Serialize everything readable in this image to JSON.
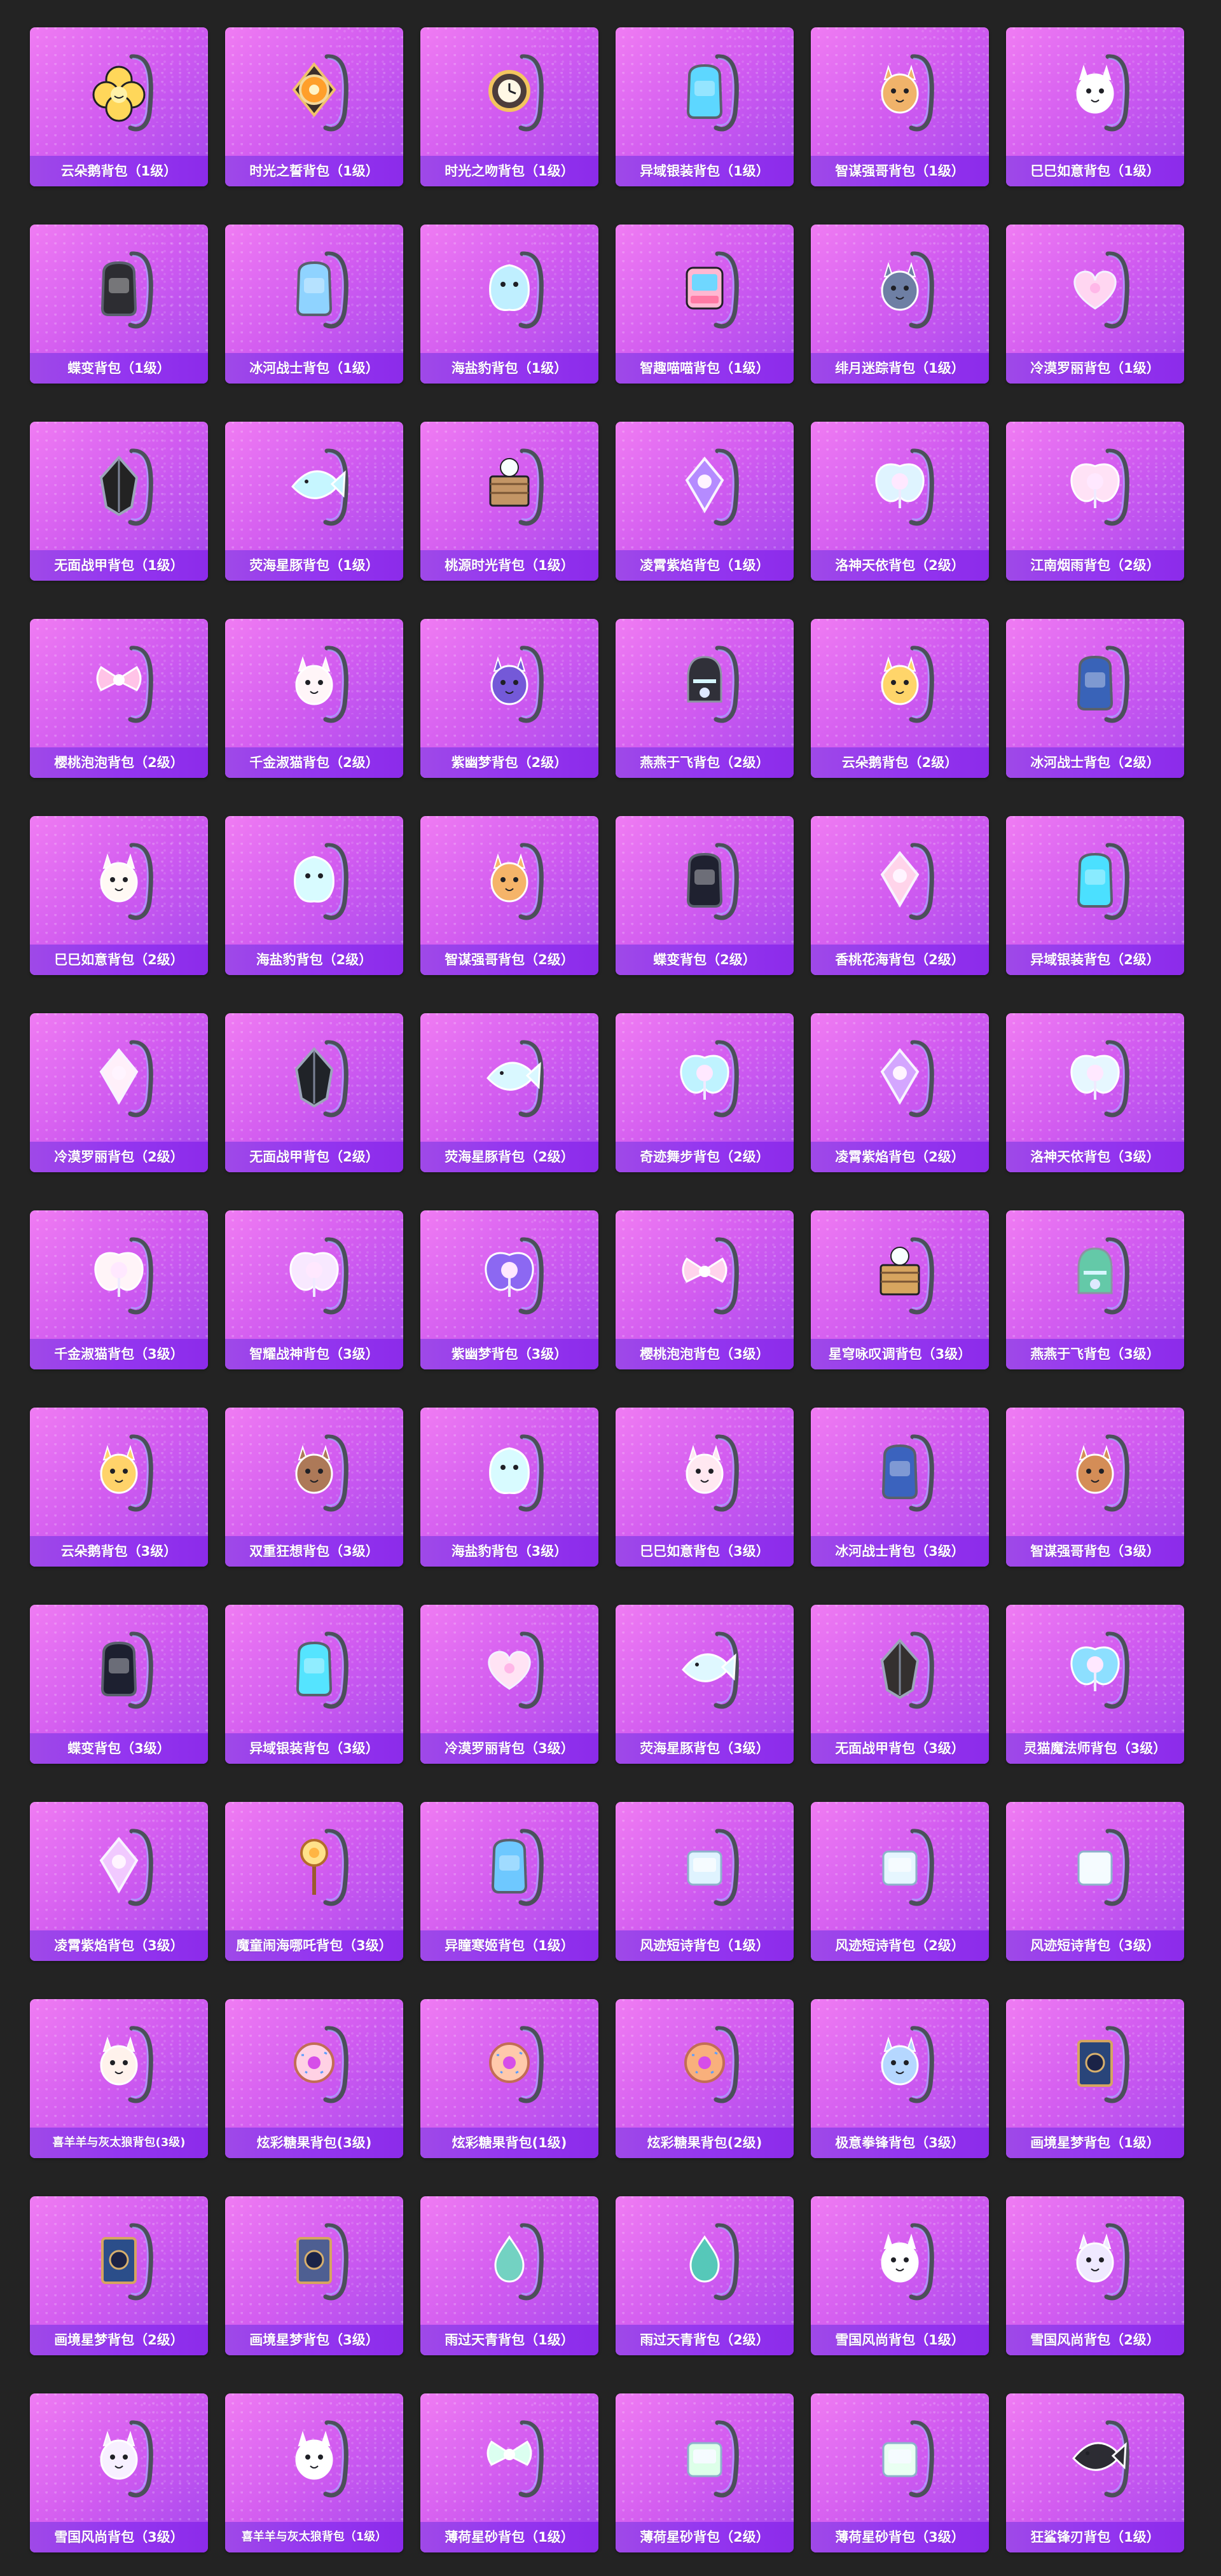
{
  "page": {
    "background": "#232323",
    "card_gradient": [
      "#f07cf3",
      "#d25cf0",
      "#a246ee"
    ],
    "label_bar": "#9436f0"
  },
  "items": [
    {
      "name": "云朵鹅背包（1级）",
      "icon": "flower-backpack-icon",
      "accent": "#ffd75a",
      "shape": "flower"
    },
    {
      "name": "时光之誓背包（1级）",
      "icon": "compass-backpack-icon",
      "accent": "#ff9f2b",
      "shape": "compass"
    },
    {
      "name": "时光之吻背包（1级）",
      "icon": "pocketwatch-backpack-icon",
      "accent": "#f3c55f",
      "shape": "watch"
    },
    {
      "name": "异域银装背包（1级）",
      "icon": "silver-backpack-icon",
      "accent": "#5dd7ff",
      "shape": "pack"
    },
    {
      "name": "智谋强哥背包（1级）",
      "icon": "dog-backpack-icon",
      "accent": "#f0b36a",
      "shape": "animal"
    },
    {
      "name": "巳巳如意背包（1级）",
      "icon": "rabbit-backpack-icon",
      "accent": "#ffffff",
      "shape": "animal"
    },
    {
      "name": "蝶变背包（1级）",
      "icon": "butterfly-backpack-icon",
      "accent": "#2d2d32",
      "shape": "pack"
    },
    {
      "name": "冰河战士背包（1级）",
      "icon": "ice-warrior-backpack-icon",
      "accent": "#8fd3ff",
      "shape": "pack"
    },
    {
      "name": "海盐豹背包（1级）",
      "icon": "seal-backpack-icon",
      "accent": "#bfefff",
      "shape": "blob"
    },
    {
      "name": "智趣喵喵背包（1级）",
      "icon": "robot-cat-backpack-icon",
      "accent": "#ffb7d2",
      "shape": "robot"
    },
    {
      "name": "绯月迷踪背包（1级）",
      "icon": "rabbit-mask-backpack-icon",
      "accent": "#6e7fa4",
      "shape": "animal"
    },
    {
      "name": "冷漠罗丽背包（1级）",
      "icon": "heart-backpack-icon",
      "accent": "#ffd6f1",
      "shape": "heart"
    },
    {
      "name": "无面战甲背包（1级）",
      "icon": "armor-backpack-icon",
      "accent": "#232323",
      "shape": "armor"
    },
    {
      "name": "荧海星豚背包（1级）",
      "icon": "fish-backpack-icon",
      "accent": "#c6f6ff",
      "shape": "fish"
    },
    {
      "name": "桃源时光背包（1级）",
      "icon": "box-bunny-backpack-icon",
      "accent": "#c39565",
      "shape": "box"
    },
    {
      "name": "凌霄紫焰背包（1级）",
      "icon": "violet-flame-backpack-icon",
      "accent": "#b58bff",
      "shape": "gem"
    },
    {
      "name": "洛神天依背包（2级）",
      "icon": "crystal-wing-backpack-icon",
      "accent": "#dff4ff",
      "shape": "wing"
    },
    {
      "name": "江南烟雨背包（2级）",
      "icon": "flower-wing-backpack-icon",
      "accent": "#ffe2f6",
      "shape": "wing"
    },
    {
      "name": "樱桃泡泡背包（2级）",
      "icon": "bow-backpack-icon",
      "accent": "#ffc3e7",
      "shape": "bow"
    },
    {
      "name": "千金淑猫背包（2级）",
      "icon": "cat-bow-backpack-icon",
      "accent": "#fff5f8",
      "shape": "animal"
    },
    {
      "name": "紫幽梦背包（2级）",
      "icon": "purple-bunny-backpack-icon",
      "accent": "#7459d8",
      "shape": "animal"
    },
    {
      "name": "燕燕于飞背包（2级）",
      "icon": "helmet-backpack-icon",
      "accent": "#303039",
      "shape": "helmet"
    },
    {
      "name": "云朵鹅背包（2级）",
      "icon": "lion-backpack-icon",
      "accent": "#ffd56a",
      "shape": "animal"
    },
    {
      "name": "冰河战士背包（2级）",
      "icon": "blue-pack-icon",
      "accent": "#3963b8",
      "shape": "pack"
    },
    {
      "name": "巳巳如意背包（2级）",
      "icon": "white-rabbit-backpack-icon",
      "accent": "#fff9f4",
      "shape": "animal"
    },
    {
      "name": "海盐豹背包（2级）",
      "icon": "unicorn-seal-backpack-icon",
      "accent": "#d8fbff",
      "shape": "blob"
    },
    {
      "name": "智谋强哥背包（2级）",
      "icon": "bear-backpack-icon",
      "accent": "#f5b469",
      "shape": "animal"
    },
    {
      "name": "蝶变背包（2级）",
      "icon": "black-butterfly-backpack-icon",
      "accent": "#1f2130",
      "shape": "pack"
    },
    {
      "name": "香桃花海背包（2级）",
      "icon": "pink-gem-backpack-icon",
      "accent": "#ffd4ea",
      "shape": "gem"
    },
    {
      "name": "异域银装背包（2级）",
      "icon": "tech-backpack-icon",
      "accent": "#4be0ff",
      "shape": "pack"
    },
    {
      "name": "冷漠罗丽背包（2级）",
      "icon": "pink-crystal-backpack-icon",
      "accent": "#fff0fa",
      "shape": "gem"
    },
    {
      "name": "无面战甲背包（2级）",
      "icon": "dark-armor-backpack-icon",
      "accent": "#202328",
      "shape": "armor"
    },
    {
      "name": "荧海星豚背包（2级）",
      "icon": "crystal-fish-backpack-icon",
      "accent": "#d9f8ff",
      "shape": "fish"
    },
    {
      "name": "奇迹舞步背包（2级）",
      "icon": "dancer-backpack-icon",
      "accent": "#bff3ff",
      "shape": "wing"
    },
    {
      "name": "凌霄紫焰背包（2级）",
      "icon": "purple-orb-backpack-icon",
      "accent": "#d4a6ff",
      "shape": "gem"
    },
    {
      "name": "洛神天依背包（3级）",
      "icon": "azure-wing-backpack-icon",
      "accent": "#e6f7ff",
      "shape": "wing"
    },
    {
      "name": "千金淑猫背包（3级）",
      "icon": "floral-cat-backpack-icon",
      "accent": "#fff4f8",
      "shape": "wing"
    },
    {
      "name": "智耀战神背包（3级）",
      "icon": "war-god-backpack-icon",
      "accent": "#f8e8ff",
      "shape": "wing"
    },
    {
      "name": "紫幽梦背包（3级）",
      "icon": "dream-bunny-backpack-icon",
      "accent": "#8c68f2",
      "shape": "wing"
    },
    {
      "name": "樱桃泡泡背包（3级）",
      "icon": "pink-bow-backpack-icon",
      "accent": "#ffd3ec",
      "shape": "bow"
    },
    {
      "name": "星穹咏叹调背包（3级）",
      "icon": "music-box-backpack-icon",
      "accent": "#d7a55f",
      "shape": "box"
    },
    {
      "name": "燕燕于飞背包（3级）",
      "icon": "green-helmet-backpack-icon",
      "accent": "#64c9a8",
      "shape": "helmet"
    },
    {
      "name": "云朵鹅背包（3级）",
      "icon": "lion-pack-icon",
      "accent": "#ffd36a",
      "shape": "animal"
    },
    {
      "name": "双重狂想背包（3级）",
      "icon": "deer-backpack-icon",
      "accent": "#ad7958",
      "shape": "animal"
    },
    {
      "name": "海盐豹背包（3级）",
      "icon": "crowned-seal-backpack-icon",
      "accent": "#d8fbff",
      "shape": "blob"
    },
    {
      "name": "巳巳如意背包（3级）",
      "icon": "cream-rabbit-backpack-icon",
      "accent": "#ffe8f1",
      "shape": "animal"
    },
    {
      "name": "冰河战士背包（3级）",
      "icon": "navy-pack-icon",
      "accent": "#3b63be",
      "shape": "pack"
    },
    {
      "name": "智谋强哥背包（3级）",
      "icon": "brown-dog-backpack-icon",
      "accent": "#d48d57",
      "shape": "animal"
    },
    {
      "name": "蝶变背包（3级）",
      "icon": "crystal-butterfly-backpack-icon",
      "accent": "#1d2030",
      "shape": "pack"
    },
    {
      "name": "异域银装背包（3级）",
      "icon": "teal-tech-backpack-icon",
      "accent": "#55e4ff",
      "shape": "pack"
    },
    {
      "name": "冷漠罗丽背包（3级）",
      "icon": "diamond-heart-backpack-icon",
      "accent": "#ffe3f4",
      "shape": "heart"
    },
    {
      "name": "荧海星豚背包（3级）",
      "icon": "glass-fish-backpack-icon",
      "accent": "#dff8ff",
      "shape": "fish"
    },
    {
      "name": "无面战甲背包（3级）",
      "icon": "gold-armor-backpack-icon",
      "accent": "#34302f",
      "shape": "armor"
    },
    {
      "name": "灵猫魔法师背包（3级）",
      "icon": "mage-cat-backpack-icon",
      "accent": "#8ddfff",
      "shape": "wing"
    },
    {
      "name": "凌霄紫焰背包（3级）",
      "icon": "lavender-orb-backpack-icon",
      "accent": "#f1c9ff",
      "shape": "gem"
    },
    {
      "name": "魔童闹海哪吒背包（3级）",
      "icon": "staff-backpack-icon",
      "accent": "#ffb543",
      "shape": "staff"
    },
    {
      "name": "异瞳寒姬背包（1级）",
      "icon": "blue-stripe-backpack-icon",
      "accent": "#6ec8ff",
      "shape": "pack"
    },
    {
      "name": "风迹短诗背包（1级）",
      "icon": "sky-tote-backpack-icon",
      "accent": "#dff3ff",
      "shape": "bag"
    },
    {
      "name": "风迹短诗背包（2级）",
      "icon": "floral-tote-backpack-icon",
      "accent": "#e6f6ff",
      "shape": "bag"
    },
    {
      "name": "风迹短诗背包（3级）",
      "icon": "cloud-tote-backpack-icon",
      "accent": "#f4fbff",
      "shape": "bag"
    },
    {
      "name": "喜羊羊与灰太狼背包(3级)",
      "icon": "sheep-backpack-icon",
      "accent": "#fff2ec",
      "shape": "animal"
    },
    {
      "name": "炫彩糖果背包(3级)",
      "icon": "donut-backpack-icon",
      "accent": "#ffd1e4",
      "shape": "donut"
    },
    {
      "name": "炫彩糖果背包(1级)",
      "icon": "donut-pack-icon",
      "accent": "#ffc9ab",
      "shape": "donut"
    },
    {
      "name": "炫彩糖果背包(2级)",
      "icon": "sprinkle-donut-backpack-icon",
      "accent": "#f9b07c",
      "shape": "donut"
    },
    {
      "name": "极意拳锋背包（3级）",
      "icon": "fist-backpack-icon",
      "accent": "#b5d7ff",
      "shape": "animal"
    },
    {
      "name": "画境星梦背包（1级）",
      "icon": "book-backpack-icon",
      "accent": "#29457a",
      "shape": "book"
    },
    {
      "name": "画境星梦背包（2级）",
      "icon": "blue-book-backpack-icon",
      "accent": "#2b4e8a",
      "shape": "book"
    },
    {
      "name": "画境星梦背包（3级）",
      "icon": "ornate-book-backpack-icon",
      "accent": "#4e5f92",
      "shape": "book"
    },
    {
      "name": "雨过天青背包（1级）",
      "icon": "droplet-backpack-icon",
      "accent": "#73d2c2",
      "shape": "drop"
    },
    {
      "name": "雨过天青背包（2级）",
      "icon": "teal-droplet-backpack-icon",
      "accent": "#56c8b9",
      "shape": "drop"
    },
    {
      "name": "雪国风尚背包（1级）",
      "icon": "snow-bunny-backpack-icon",
      "accent": "#ffffff",
      "shape": "animal"
    },
    {
      "name": "雪国风尚背包（2级）",
      "icon": "purple-snow-backpack-icon",
      "accent": "#efe9ff",
      "shape": "animal"
    },
    {
      "name": "雪国风尚背包（3级）",
      "icon": "penguin-backpack-icon",
      "accent": "#f7f0ff",
      "shape": "animal"
    },
    {
      "name": "喜羊羊与灰太狼背包（1级）",
      "icon": "fluffy-sheep-backpack-icon",
      "accent": "#ffffff",
      "shape": "animal"
    },
    {
      "name": "薄荷星砂背包（1级）",
      "icon": "mint-bow-backpack-icon",
      "accent": "#dbfff0",
      "shape": "bow"
    },
    {
      "name": "薄荷星砂背包（2级）",
      "icon": "mint-bag-backpack-icon",
      "accent": "#ddffe9",
      "shape": "bag"
    },
    {
      "name": "薄荷星砂背包（3级）",
      "icon": "mint-crystal-backpack-icon",
      "accent": "#e9fff2",
      "shape": "bag"
    },
    {
      "name": "狂鲨锋刃背包（1级）",
      "icon": "shark-backpack-icon",
      "accent": "#2c2c33",
      "shape": "fish"
    }
  ]
}
